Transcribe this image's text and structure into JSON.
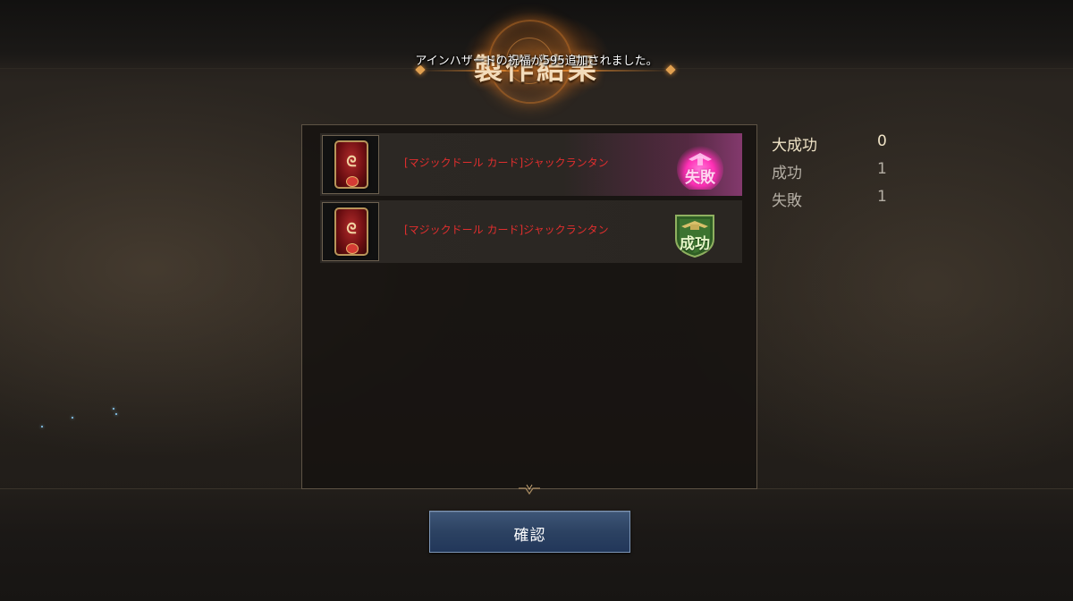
{
  "screen": {
    "title": "製作結果",
    "notice": "アインハザードの祝福が595追加されました。"
  },
  "results": [
    {
      "item_name": "[マジックドール カード]ジャックランタン",
      "status": "失敗",
      "status_type": "fail",
      "status_color": "#ff3fc0"
    },
    {
      "item_name": "[マジックドール カード]ジャックランタン",
      "status": "成功",
      "status_type": "success",
      "status_color": "#3f7a2f"
    }
  ],
  "stats": {
    "great_success": {
      "label": "大成功",
      "value": "0"
    },
    "success": {
      "label": "成功",
      "value": "1"
    },
    "fail": {
      "label": "失敗",
      "value": "1"
    }
  },
  "confirm_button": {
    "label": "確認"
  },
  "icons": {
    "item": "magic-doll-card-icon",
    "fail_badge": "fail-badge-icon",
    "success_badge": "success-badge-icon"
  },
  "colors": {
    "item_name": "#e12e2e",
    "button": "#2c4262",
    "title_glow": "#ff8c28"
  }
}
